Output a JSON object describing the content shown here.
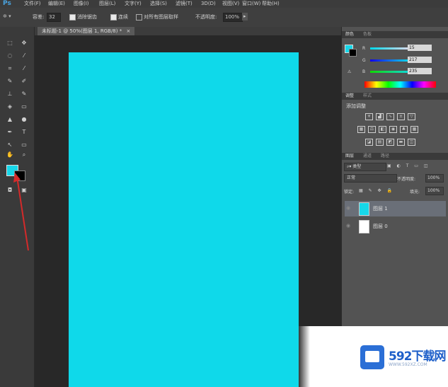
{
  "menubar": {
    "logo": "Ps",
    "items": [
      "文件(F)",
      "编辑(E)",
      "图像(I)",
      "图层(L)",
      "文字(Y)",
      "选择(S)",
      "滤镜(T)",
      "3D(D)",
      "视图(V)",
      "窗口(W)",
      "帮助(H)"
    ]
  },
  "options": {
    "feather_label": "容差:",
    "feather_value": "32",
    "antialias_label": "消除锯齿",
    "contiguous_label": "连续",
    "all_layers_label": "对所有图层取样",
    "opacity_label": "不透明度:",
    "opacity_value": "100%"
  },
  "document": {
    "tab_title": "未标题-1 @ 50%(图层 1, RGB/8) *",
    "close": "×",
    "canvas_color": "#0fd9ea"
  },
  "colors": {
    "foreground": "#17d7e9",
    "background": "#000000"
  },
  "color_panel": {
    "tab1": "颜色",
    "tab2": "色板",
    "r_label": "R",
    "g_label": "G",
    "b_label": "B",
    "r_value": "15",
    "g_value": "217",
    "b_value": "235"
  },
  "adjustments_panel": {
    "tab1": "调整",
    "tab2": "样式",
    "title": "添加调整"
  },
  "layers_panel": {
    "tab1": "图层",
    "tab2": "通道",
    "tab3": "路径",
    "kind_label": "类型",
    "blend_mode": "正常",
    "opacity_label": "不透明度:",
    "opacity_value": "100%",
    "lock_label": "锁定:",
    "fill_label": "填充:",
    "fill_value": "100%",
    "layers": [
      {
        "name": "图层 1",
        "color": "#17d7e9"
      },
      {
        "name": "图层 0",
        "color": "#ffffff"
      }
    ]
  },
  "watermark": {
    "brand": "592下载网",
    "url": "WWW.592XZ.COM"
  }
}
